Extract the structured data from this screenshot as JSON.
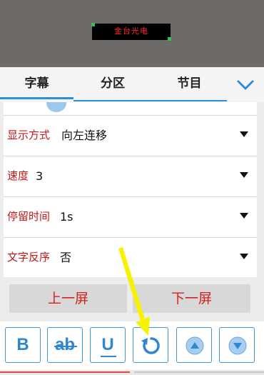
{
  "preview": {
    "led_text": "金台光电"
  },
  "tabs": [
    {
      "label": "字幕"
    },
    {
      "label": "分区"
    },
    {
      "label": "节目"
    }
  ],
  "settings": {
    "rows": [
      {
        "label": "显示方式",
        "value": "向左连移"
      },
      {
        "label": "速度",
        "value": "3"
      },
      {
        "label": "停留时间",
        "value": "1s"
      },
      {
        "label": "文字反序",
        "value": "否"
      }
    ]
  },
  "pager": {
    "prev_label": "上一屏",
    "next_label": "下一屏"
  },
  "toolbar": {
    "bold_label": "B",
    "strike_label": "ab",
    "underline_label": "U"
  },
  "colors": {
    "accent": "#2f8fd6",
    "label_red": "#c01818",
    "highlight_arrow": "#f7f200"
  }
}
